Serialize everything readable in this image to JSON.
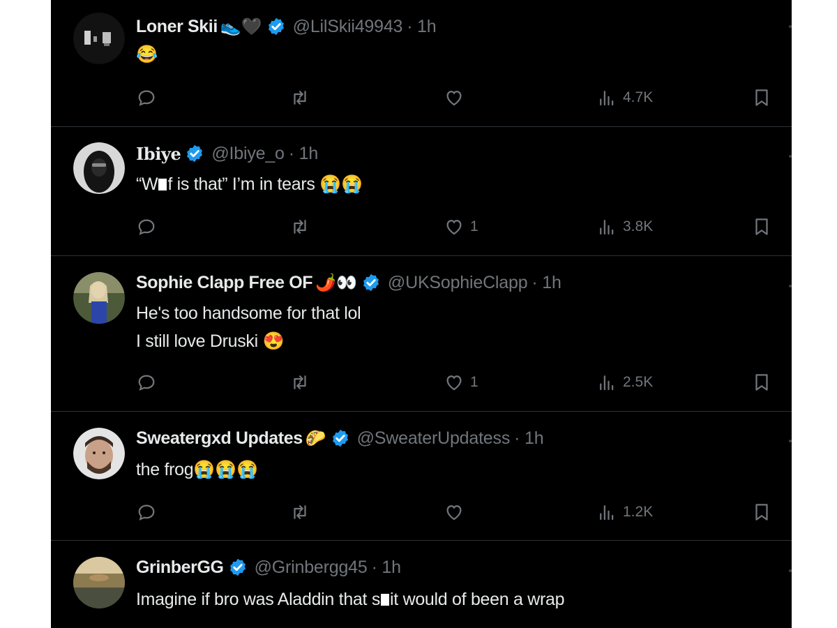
{
  "tweets": [
    {
      "name": "Loner Skii",
      "name_emoji": "👟🖤",
      "handle": "@LilSkii49943",
      "time": "· 1h",
      "lines": [
        "😂"
      ],
      "replies": "",
      "retweets": "",
      "likes": "",
      "views": "4.7K"
    },
    {
      "name": "Ibiye",
      "name_emoji": "",
      "handle": "@Ibiye_o",
      "time": "· 1h",
      "lines_pre": "“W",
      "lines_post": "f is that” I’m in tears 😭😭",
      "replies": "",
      "retweets": "",
      "likes": "1",
      "views": "3.8K"
    },
    {
      "name": "Sophie Clapp Free OF",
      "name_emoji": "🌶️👀",
      "handle": "@UKSophieClapp",
      "time": "· 1h",
      "lines": [
        "He's too handsome for that lol",
        "I still love Druski 😍"
      ],
      "replies": "",
      "retweets": "",
      "likes": "1",
      "views": "2.5K"
    },
    {
      "name": "Sweatergxd Updates",
      "name_emoji": "🌮",
      "handle": "@SweaterUpdatess",
      "time": "· 1h",
      "lines": [
        "the frog😭😭😭"
      ],
      "replies": "",
      "retweets": "",
      "likes": "",
      "views": "1.2K"
    },
    {
      "name": "GrinberGG",
      "name_emoji": "",
      "handle": "@Grinbergg45",
      "time": "· 1h",
      "lines_pre": "Imagine if bro was Aladdin that s",
      "lines_post": "it would of been a wrap"
    }
  ],
  "icons": {
    "reply": "reply-icon",
    "retweet": "retweet-icon",
    "like": "heart-icon",
    "views": "views-icon",
    "bookmark": "bookmark-icon",
    "verified": "verified-badge-icon"
  },
  "colors": {
    "background": "#000000",
    "text": "#e7e9ea",
    "muted": "#71767b",
    "verified": "#1d9bf0",
    "divider": "#2f3336"
  }
}
